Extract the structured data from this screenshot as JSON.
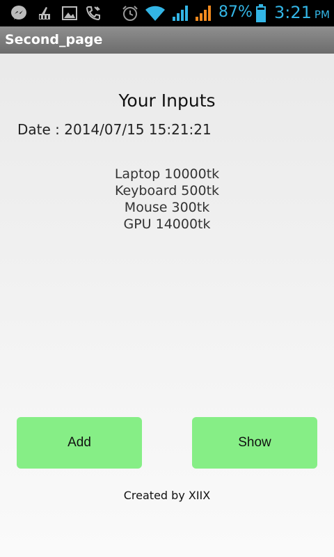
{
  "status_bar": {
    "battery_percent": "87%",
    "time": "3:21",
    "ampm": "PM",
    "icons": [
      "messenger-icon",
      "cleaner-icon",
      "gallery-icon",
      "phone-call-icon",
      "alarm-icon",
      "wifi-icon",
      "signal-1-icon",
      "signal-2-icon",
      "battery-icon"
    ],
    "accent_color": "#33b5e5"
  },
  "title_bar": {
    "title": "Second_page"
  },
  "content": {
    "heading": "Your Inputs",
    "date_line": "Date : 2014/07/15 15:21:21",
    "items": [
      "Laptop 10000tk",
      "Keyboard 500tk",
      "Mouse 300tk",
      "GPU 14000tk"
    ]
  },
  "buttons": {
    "add_label": "Add",
    "show_label": "Show",
    "color": "#86ee86"
  },
  "footer": {
    "text": "Created by XIIX"
  }
}
